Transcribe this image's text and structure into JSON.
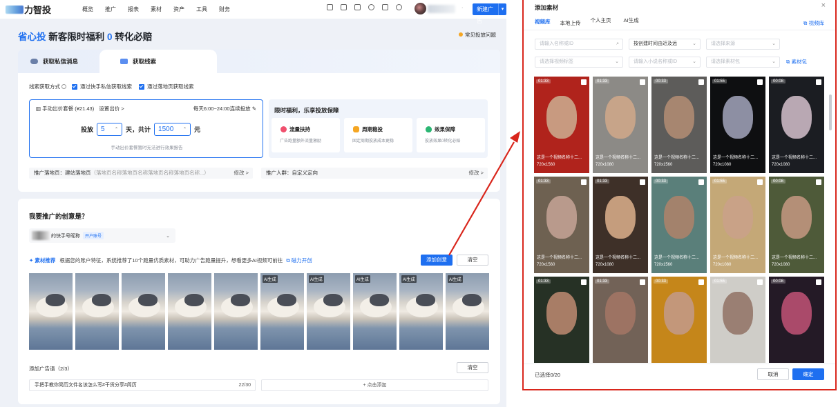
{
  "topbar": {
    "logo_text": "力智投",
    "nav": [
      "概览",
      "推广",
      "报表",
      "素材",
      "资产",
      "工具",
      "财务"
    ],
    "icons": [
      "gift-icon",
      "doc-icon",
      "phone-icon",
      "bell-icon",
      "chat-icon",
      "help-icon"
    ],
    "new_ad_label": "新建广告",
    "new_ad_caret": "▾",
    "account_caret": "·"
  },
  "headline": {
    "prefix": "省心投",
    "text1": " 新客限时福利 ",
    "highlight": "0",
    "text2": " 转化必赔"
  },
  "faq": "常见投放问题",
  "lead": {
    "tabs": [
      "获取私信消息",
      "获取线索"
    ],
    "method_label": "线索获取方式",
    "options": [
      "通过快手私信获取线索",
      "通过落地页获取线索"
    ],
    "bid_package": "手动出价套餐 (¥21.43)",
    "bid_setting": "设置出价 >",
    "schedule": "每天6:00~24:00连续投放",
    "edit_icon": "✎",
    "bid_prefix": "投放",
    "days": "5",
    "bid_mid": "天，共计",
    "amount": "1500",
    "bid_unit": "元",
    "spin_caret": "⌃",
    "bid_note": "手动出价套餐暂时无法进行效果报告",
    "benefit_title": "限时福利，乐享投放保障",
    "benefits": [
      {
        "title": "流量扶持",
        "desc": "广告跑量额外流量激励",
        "color": "#f0506e"
      },
      {
        "title": "周期稳投",
        "desc": "固定周期投放成本更稳",
        "color": "#f5a623"
      },
      {
        "title": "效果保障",
        "desc": "投放效果0转化必赔",
        "color": "#2bb673"
      }
    ],
    "landing_label": "推广落地页：建站落地页",
    "landing_value": "（落地页名称落地页名称落地页名称落地页名称...）",
    "landing_edit": "修改 >",
    "audience_label": "推广人群：自定义定向",
    "audience_edit": "修改 >"
  },
  "creative": {
    "title": "我要推广的创意是？",
    "account_name": "的快手号昵称",
    "account_tag": "开户账号",
    "dropdown": "⌄",
    "rec_title": "✦ 素材推荐",
    "rec_desc": "根据您的账户特征，系统推荐了10个跑量优质素材，可助力广告跑量提升，想看更多AI视频可前往",
    "rec_link": "⧉ 磁力开创",
    "add_label": "添加创意",
    "clear_label": "清空",
    "thumbs": [
      {
        "ai": ""
      },
      {
        "ai": ""
      },
      {
        "ai": ""
      },
      {
        "ai": ""
      },
      {
        "ai": ""
      },
      {
        "ai": "AI生成"
      },
      {
        "ai": "AI生成"
      },
      {
        "ai": "AI生成"
      },
      {
        "ai": "AI生成"
      },
      {
        "ai": "AI生成"
      }
    ],
    "copy_title": "添加广告语（2/3）",
    "copy_clear": "清空",
    "copy_text": "手把手教你简历文件名该怎么写#干货分享#简历",
    "copy_count": "22/30",
    "copy_add": "+ 点击添加"
  },
  "modal": {
    "title": "添加素材",
    "close": "×",
    "tabs": [
      "视频库",
      "本地上传",
      "个人主页",
      "AI生成"
    ],
    "lib_link": "⧉ 视频库",
    "fields": {
      "name": "请输入名称或ID",
      "sort": "按创建时间由近及远",
      "source": "请选择来源",
      "tag": "请选择视频标签",
      "app": "请输入小说名称或ID",
      "pack": "请选择素材包",
      "sort_caret": "⌄",
      "search_icon": "⌕"
    },
    "material_pack": "⧉ 素材包",
    "videos": [
      {
        "duration": "01:33",
        "caption": "这是一个视频名称十二...",
        "res": "720x1560",
        "bg": "#b0231c",
        "face": "#c89a80"
      },
      {
        "duration": "01:33",
        "caption": "这是一个视频名称十二...",
        "res": "720x1080",
        "bg": "#8c8a86",
        "face": "#c7a489"
      },
      {
        "duration": "00:33",
        "caption": "这是一个视频名称十二...",
        "res": "720x1560",
        "bg": "#5d5c5a",
        "face": "#a78670"
      },
      {
        "duration": "01:55",
        "caption": "这是一个视频名称十二...",
        "res": "720x1080",
        "bg": "#0e0f11",
        "face": "#8d8fa3"
      },
      {
        "duration": "00:08",
        "caption": "这是一个视频名称十二...",
        "res": "720x1080",
        "bg": "#1b1d22",
        "face": "#b9a8b3"
      },
      {
        "duration": "01:33",
        "caption": "这是一个视频名称十二...",
        "res": "720x1560",
        "bg": "#6e6151",
        "face": "#b99a8c"
      },
      {
        "duration": "01:33",
        "caption": "这是一个视频名称十二...",
        "res": "720x1080",
        "bg": "#3e3028",
        "face": "#c59d7d"
      },
      {
        "duration": "00:33",
        "caption": "这是一个视频名称十二...",
        "res": "720x1560",
        "bg": "#5a7f7a",
        "face": "#a3826c"
      },
      {
        "duration": "01:55",
        "caption": "这是一个视频名称十二...",
        "res": "720x1080",
        "bg": "#c4a877",
        "face": "#c9a287"
      },
      {
        "duration": "00:08",
        "caption": "这是一个视频名称十二...",
        "res": "720x1080",
        "bg": "#4e5a39",
        "face": "#b48f77"
      },
      {
        "duration": "01:33",
        "caption": "",
        "res": "",
        "bg": "#263125",
        "face": "#a87d66"
      },
      {
        "duration": "01:33",
        "caption": "",
        "res": "",
        "bg": "#726257",
        "face": "#9d7363"
      },
      {
        "duration": "00:33",
        "caption": "",
        "res": "",
        "bg": "#c5861a",
        "face": "#c3977a"
      },
      {
        "duration": "01:55",
        "caption": "",
        "res": "",
        "bg": "#cfcdc8",
        "face": "#9a7f73"
      },
      {
        "duration": "00:08",
        "caption": "",
        "res": "",
        "bg": "#241a26",
        "face": "#aa4a6a"
      }
    ],
    "selected": "已选择0/20",
    "cancel": "取消",
    "ok": "确定"
  },
  "colors": {
    "primary": "#1e6ff0",
    "annotation": "#d9261c"
  }
}
